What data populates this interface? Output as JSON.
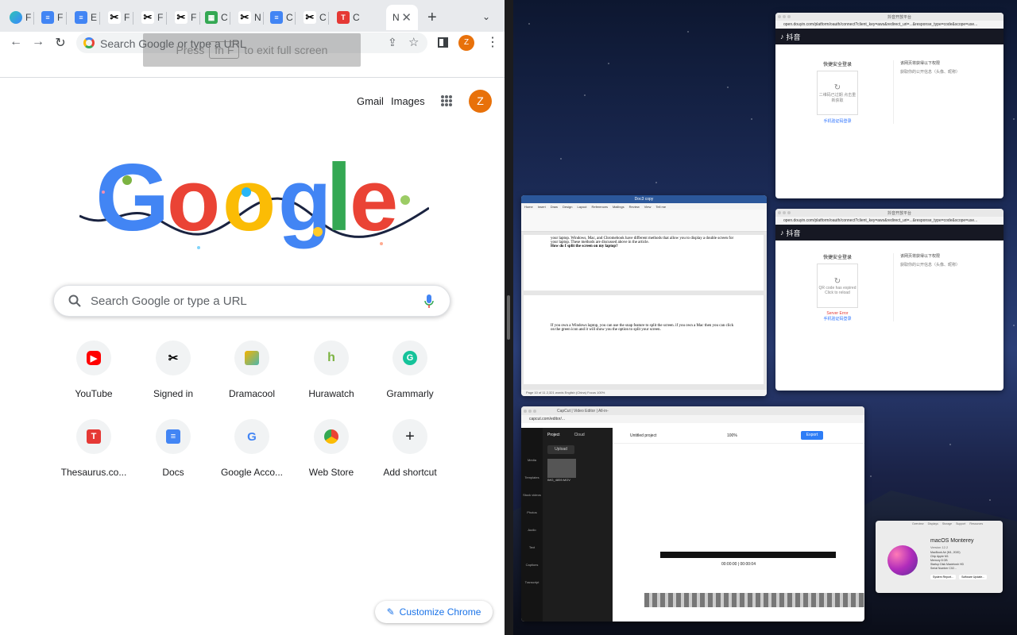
{
  "chrome": {
    "tabs": [
      {
        "label": "F",
        "icon": "chatgpt-icon"
      },
      {
        "label": "F",
        "icon": "google-docs-icon"
      },
      {
        "label": "E",
        "icon": "google-docs-icon"
      },
      {
        "label": "F",
        "icon": "capcut-icon"
      },
      {
        "label": "F",
        "icon": "capcut-icon"
      },
      {
        "label": "F",
        "icon": "capcut-icon"
      },
      {
        "label": "C",
        "icon": "google-sheets-icon"
      },
      {
        "label": "N",
        "icon": "capcut-icon"
      },
      {
        "label": "C",
        "icon": "google-docs-icon"
      },
      {
        "label": "C",
        "icon": "capcut-icon"
      },
      {
        "label": "C",
        "icon": "thesaurus-icon"
      },
      {
        "label": "N",
        "icon": "",
        "active": true
      }
    ],
    "omnibox_placeholder": "Search Google or type a URL",
    "avatar_letter": "Z",
    "fullscreen_hint": {
      "before": "Press",
      "key": "fn F",
      "after": "to exit full screen"
    }
  },
  "ntp": {
    "gmail": "Gmail",
    "images": "Images",
    "avatar_letter": "Z",
    "search_placeholder": "Search Google or type a URL",
    "shortcuts_row1": [
      {
        "label": "YouTube",
        "icon": "youtube-icon"
      },
      {
        "label": "Signed in",
        "icon": "capcut-icon"
      },
      {
        "label": "Dramacool",
        "icon": "dramacool-icon"
      },
      {
        "label": "Hurawatch",
        "icon": "hurawatch-icon"
      },
      {
        "label": "Grammarly",
        "icon": "grammarly-icon"
      }
    ],
    "shortcuts_row2": [
      {
        "label": "Thesaurus.co...",
        "icon": "thesaurus-icon"
      },
      {
        "label": "Docs",
        "icon": "google-docs-icon"
      },
      {
        "label": "Google Acco...",
        "icon": "google-icon"
      },
      {
        "label": "Web Store",
        "icon": "web-store-icon"
      },
      {
        "label": "Add shortcut",
        "icon": "plus-icon"
      }
    ],
    "customize_label": "Customize Chrome"
  },
  "desktop": {
    "douyin1": {
      "title": "抖音开放平台",
      "url": "open.douyin.com/platform/oauth/connect?client_key=aws&redirect_uri=...&response_type=code&scope=use...",
      "brand": "抖音",
      "login_title": "快捷安全登录",
      "qr_text": "二维码已过期 点击重新获取",
      "phone_link": "手机验证码登录",
      "side_title": "该网页将获得以下权限",
      "side_item": "获取你的公开信息（头像、昵称）"
    },
    "douyin2": {
      "title": "抖音开放平台",
      "url": "open.douyin.com/platform/oauth/connect?client_key=aws&redirect_uri=...&response_type=code&scope=use...",
      "brand": "抖音",
      "login_title": "快捷安全登录",
      "qr_text": "QR code has expired Click to reload",
      "error": "Server Error",
      "phone_link": "手机验证码登录",
      "side_title": "该网页将获得以下权限",
      "side_item": "获取你的公开信息（头像、昵称）"
    },
    "word": {
      "title": "Doc3 copy",
      "ribbon_tabs": [
        "Home",
        "Insert",
        "Draw",
        "Design",
        "Layout",
        "References",
        "Mailings",
        "Review",
        "View",
        "Tell me"
      ],
      "para1": "your laptop. Windows, Mac, and Chromebook have different methods that allow you to display a double screen for your laptop. These methods are discussed above in the article.",
      "heading": "How do I split the screen on my laptop?",
      "para2": "If you own a Windows laptop, you can use the snap feature to split the screen. if you own a Mac then you can click on the green icon and it will show you the option to split your screen.",
      "status": "Page 10 of 11   2,321 words   English (China)   Focus   100%"
    },
    "capcut": {
      "tab_title": "CapCut | Video Editor | All-in-",
      "url": "capcut.com/editor/...",
      "nav": [
        "Project",
        "Cloud"
      ],
      "upload": "Upload",
      "project_name": "Untitled project",
      "zoom": "100%",
      "export": "Export",
      "side": [
        "Media",
        "Templates",
        "Stock videos",
        "Photos",
        "Audio",
        "Text",
        "Captions",
        "Transcript"
      ],
      "timecode": "00:00:00 | 00:00:04",
      "media_name": "IMG_4859.MOV"
    },
    "about_mac": {
      "tabs": [
        "Overview",
        "Displays",
        "Storage",
        "Support",
        "Resources"
      ],
      "title": "macOS Monterey",
      "version": "Version 12.2",
      "lines": [
        "MacBook Air (M1, 2020)",
        "Chip   Apple M1",
        "Memory   8 GB",
        "Startup Disk   Macintosh HD",
        "Serial Number   C02..."
      ],
      "buttons": [
        "System Report...",
        "Software Update..."
      ]
    }
  }
}
